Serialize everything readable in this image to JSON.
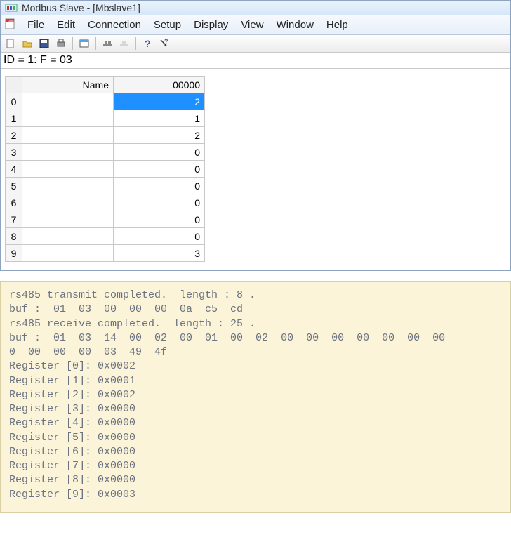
{
  "title": "Modbus Slave - [Mbslave1]",
  "menu": {
    "items": [
      "File",
      "Edit",
      "Connection",
      "Setup",
      "Display",
      "View",
      "Window",
      "Help"
    ]
  },
  "toolbar_icons": [
    "new-icon",
    "open-icon",
    "save-icon",
    "print-icon",
    "sep",
    "window-icon",
    "sep",
    "connect-icon",
    "disconnect-icon",
    "sep",
    "help-icon",
    "context-help-icon"
  ],
  "info_line": "ID = 1: F = 03",
  "table": {
    "columns": [
      "Name",
      "00000"
    ],
    "rows": [
      {
        "idx": "0",
        "name": "",
        "value": "2",
        "selected": true
      },
      {
        "idx": "1",
        "name": "",
        "value": "1",
        "selected": false
      },
      {
        "idx": "2",
        "name": "",
        "value": "2",
        "selected": false
      },
      {
        "idx": "3",
        "name": "",
        "value": "0",
        "selected": false
      },
      {
        "idx": "4",
        "name": "",
        "value": "0",
        "selected": false
      },
      {
        "idx": "5",
        "name": "",
        "value": "0",
        "selected": false
      },
      {
        "idx": "6",
        "name": "",
        "value": "0",
        "selected": false
      },
      {
        "idx": "7",
        "name": "",
        "value": "0",
        "selected": false
      },
      {
        "idx": "8",
        "name": "",
        "value": "0",
        "selected": false
      },
      {
        "idx": "9",
        "name": "",
        "value": "3",
        "selected": false
      }
    ]
  },
  "console_lines": [
    "rs485 transmit completed.  length : 8 .",
    "buf :  01  03  00  00  00  0a  c5  cd",
    "rs485 receive completed.  length : 25 .",
    "buf :  01  03  14  00  02  00  01  00  02  00  00  00  00  00  00  00",
    "0  00  00  00  03  49  4f",
    "Register [0]: 0x0002",
    "Register [1]: 0x0001",
    "Register [2]: 0x0002",
    "Register [3]: 0x0000",
    "Register [4]: 0x0000",
    "Register [5]: 0x0000",
    "Register [6]: 0x0000",
    "Register [7]: 0x0000",
    "Register [8]: 0x0000",
    "Register [9]: 0x0003"
  ]
}
